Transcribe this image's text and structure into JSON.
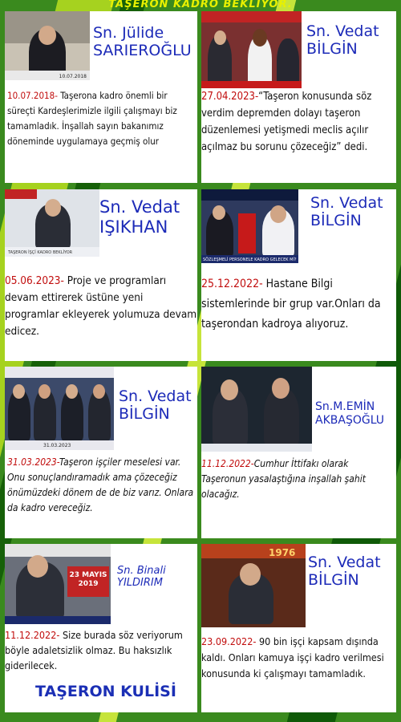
{
  "header": {
    "title": "TAŞERON KADRO BEKLİYOR."
  },
  "colors": {
    "background": "#3a8a1e",
    "name": "#1d2bb8",
    "date": "#c10d0d",
    "header": "#e8f000"
  },
  "cards": [
    {
      "name_line1": "Sn. Jülide",
      "name_line2": "SARIEROĞLU",
      "photo_caption": "10.07.2018",
      "date": "10.07.2018-",
      "text": " Taşerona kadro önemli bir süreçti Kardeşlerimizle ilgili çalışmayı biz tamamladık. İnşallah sayın bakanımız döneminde uygulamaya geçmiş olur"
    },
    {
      "name_line1": "Sn. Vedat",
      "name_line2": "BİLGİN",
      "date": "27.04.2023-",
      "text": "“Taşeron konusunda söz verdim depremden dolayı taşeron düzenlemesi yetişmedi meclis açılır açılmaz bu sorunu çözeceğiz” dedi."
    },
    {
      "name_line1": "Sn. Vedat",
      "name_line2": "IŞIKHAN",
      "photo_caption": "TAŞERON İŞÇİ KADRO BEKLİYOR",
      "date": "05.06.2023-",
      "text": " Proje ve programları devam ettirerek üstüne yeni programlar ekleyerek yolumuza devam edicez."
    },
    {
      "name_line1": "Sn. Vedat",
      "name_line2": "BİLGİN",
      "photo_caption": "SÖZLEŞMELİ PERSONELE KADRO GELECEK Mİ?",
      "date": "25.12.2022-",
      "text": " Hastane Bilgi sistemlerinde bir grup var.Onları da taşerondan kadroya alıyoruz."
    },
    {
      "name_line1": "Sn. Vedat",
      "name_line2": "BİLGİN",
      "photo_caption": "31.03.2023",
      "date": "31.03.2023-",
      "text": "Taşeron işçiler meselesi var. Onu sonuçlandıramadık ama çözeceğiz önümüzdeki dönem de de biz varız. Onlara da kadro vereceğiz."
    },
    {
      "name_line1": "Sn.M.EMİN",
      "name_line2": "AKBAŞOĞLU",
      "date": "11.12.2022-",
      "text": "Cumhur İttifakı olarak Taşeronun yasalaştığına inşallah şahit olacağız."
    },
    {
      "name_line1": "Sn. Binali",
      "name_line2": "YILDIRIM",
      "photo_caption": "23 MAYIS 2019",
      "date": "11.12.2022-",
      "text": " Size burada söz veriyorum böyle adaletsizlik olmaz. Bu haksızlık giderilecek."
    },
    {
      "name_line1": "Sn. Vedat",
      "name_line2": "BİLGİN",
      "photo_caption": "1976",
      "date": "23.09.2022-",
      "text": " 90 bin işçi kapsam dışında kaldı. Onları kamuya işçi kadro verilmesi konusunda ki çalışmayı tamamladık."
    }
  ],
  "footer": {
    "brand": "TAŞERON KULİSİ"
  }
}
